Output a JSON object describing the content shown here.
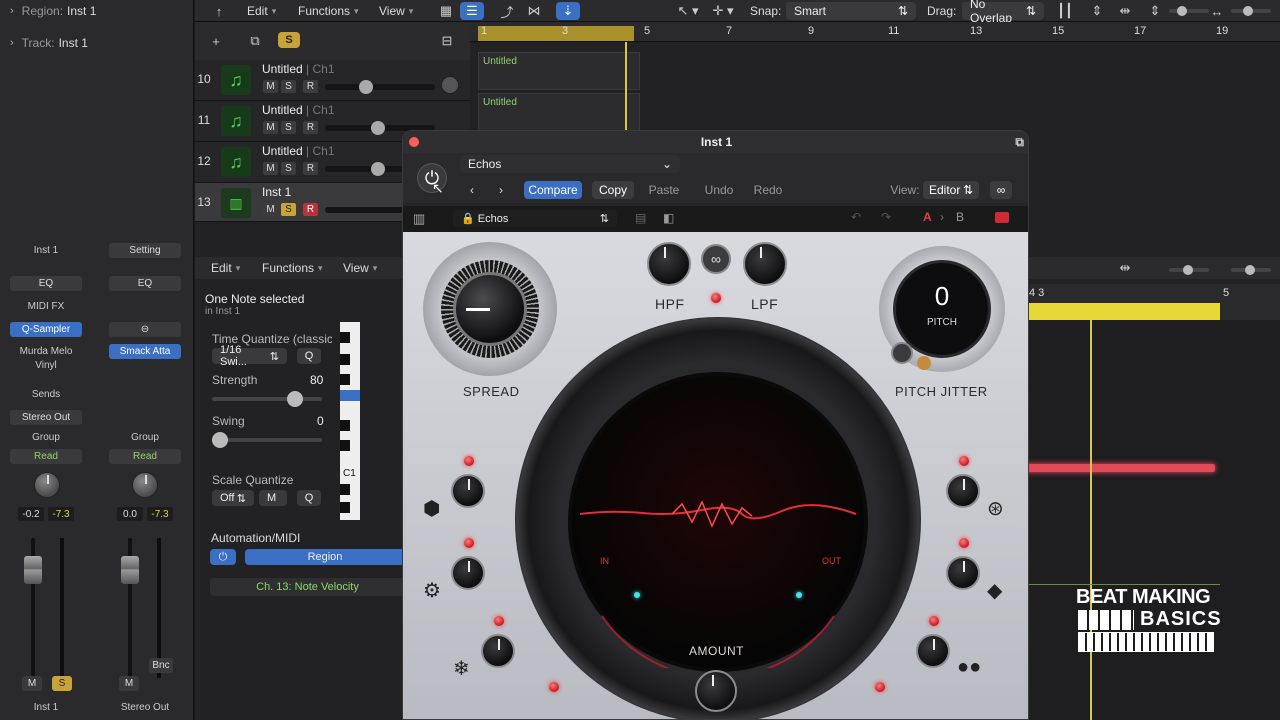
{
  "inspector": {
    "region_key": "Region:",
    "region_value": "Inst 1",
    "track_key": "Track:",
    "track_value": "Inst 1",
    "strip1": {
      "name": "Inst 1",
      "eq": "EQ",
      "midi_fx": "MIDI FX",
      "instrument": "Q-Sampler",
      "plugin1": "Murda Melo",
      "plugin2": "Vinyl",
      "sends": "Sends",
      "output": "Stereo Out",
      "group": "Group",
      "automation": "Read",
      "pan_value": "-0.2",
      "level_value": "-7.3",
      "mute": "M",
      "solo": "S",
      "footer": "Inst 1"
    },
    "strip2": {
      "name": "Setting",
      "eq": "EQ",
      "link_icon": "link-icon",
      "instrument": "Smack Atta",
      "group": "Group",
      "automation": "Read",
      "pan_value": "0.0",
      "level_value": "-7.3",
      "bounce": "Bnc",
      "mute": "M",
      "footer": "Stereo Out"
    }
  },
  "toolbar": {
    "edit": "Edit",
    "functions": "Functions",
    "view": "View",
    "snap_label": "Snap:",
    "snap_value": "Smart",
    "drag_label": "Drag:",
    "drag_value": "No Overlap"
  },
  "tracks": [
    {
      "num": "10",
      "name": "Untitled",
      "channel": "| Ch1",
      "m": "M",
      "s": "S",
      "r": "R"
    },
    {
      "num": "11",
      "name": "Untitled",
      "channel": "| Ch1",
      "m": "M",
      "s": "S",
      "r": "R"
    },
    {
      "num": "12",
      "name": "Untitled",
      "channel": "| Ch1",
      "m": "M",
      "s": "S",
      "r": "R"
    },
    {
      "num": "13",
      "name": "Inst 1",
      "channel": "",
      "m": "M",
      "s": "S",
      "r": "R"
    }
  ],
  "ruler": [
    "1",
    "3",
    "5",
    "7",
    "9",
    "11",
    "13",
    "15",
    "17",
    "19"
  ],
  "regions": [
    {
      "label": "Untitled"
    },
    {
      "label": "Untitled"
    }
  ],
  "editor": {
    "edit": "Edit",
    "functions": "Functions",
    "view": "View",
    "selection": "One Note selected",
    "selection_sub": "in Inst 1",
    "time_quantize_label": "Time Quantize (classic)",
    "time_quantize_value": "1/16 Swi...",
    "q": "Q",
    "strength_label": "Strength",
    "strength_value": "80",
    "strength": 0.8,
    "swing_label": "Swing",
    "swing_value": "0",
    "swing": 0,
    "scale_quantize_label": "Scale Quantize",
    "scale_off": "Off",
    "scale_key": "M",
    "automation_label": "Automation/MIDI",
    "region_button": "Region",
    "velocity_label": "Ch. 13: Note Velocity",
    "piano_c1": "C1",
    "pr_ruler_a": "4 3",
    "pr_ruler_b": "5"
  },
  "plugin": {
    "title": "Inst 1",
    "preset": "Echos",
    "compare": "Compare",
    "copy": "Copy",
    "paste": "Paste",
    "undo": "Undo",
    "redo": "Redo",
    "view_label": "View:",
    "view_value": "Editor",
    "strip_preset": "Echos",
    "ab_a": "A",
    "ab_b": "B",
    "hpf": "HPF",
    "lpf": "LPF",
    "spread": "SPREAD",
    "pitch_value": "0",
    "pitch_label": "PITCH",
    "pitch_jitter": "PITCH JITTER",
    "amount": "AMOUNT",
    "in_label": "IN",
    "out_label": "OUT"
  },
  "watermark": {
    "line1": "BEAT MAKING",
    "line2": "BASICS"
  }
}
